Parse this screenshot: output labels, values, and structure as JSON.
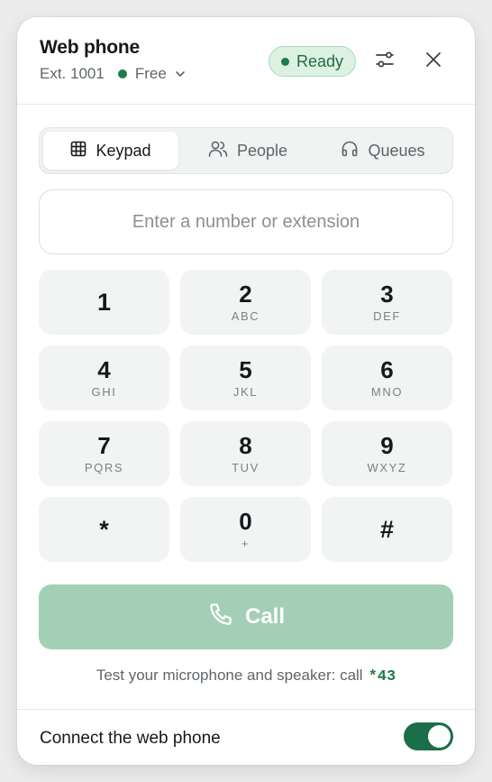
{
  "header": {
    "title": "Web phone",
    "extension": "Ext. 1001",
    "availability": "Free",
    "status_badge": "Ready"
  },
  "tabs": [
    {
      "label": "Keypad",
      "icon": "grid-icon",
      "active": true
    },
    {
      "label": "People",
      "icon": "people-icon",
      "active": false
    },
    {
      "label": "Queues",
      "icon": "headphones-icon",
      "active": false
    }
  ],
  "number_input": {
    "placeholder": "Enter a number or extension",
    "value": ""
  },
  "keypad": [
    {
      "digit": "1",
      "letters": ""
    },
    {
      "digit": "2",
      "letters": "ABC"
    },
    {
      "digit": "3",
      "letters": "DEF"
    },
    {
      "digit": "4",
      "letters": "GHI"
    },
    {
      "digit": "5",
      "letters": "JKL"
    },
    {
      "digit": "6",
      "letters": "MNO"
    },
    {
      "digit": "7",
      "letters": "PQRS"
    },
    {
      "digit": "8",
      "letters": "TUV"
    },
    {
      "digit": "9",
      "letters": "WXYZ"
    },
    {
      "digit": "*",
      "letters": ""
    },
    {
      "digit": "0",
      "letters": "+"
    },
    {
      "digit": "#",
      "letters": ""
    }
  ],
  "call_button": {
    "label": "Call",
    "icon": "phone-icon"
  },
  "test_hint": {
    "text": "Test your microphone and speaker: call",
    "code": "*43"
  },
  "footer": {
    "label": "Connect the web phone",
    "toggle_on": true
  },
  "colors": {
    "accent": "#1f7a4a",
    "call_disabled": "#a3cfb4",
    "badge_bg": "#dcf1e2",
    "key_bg": "#f2f4f4"
  }
}
